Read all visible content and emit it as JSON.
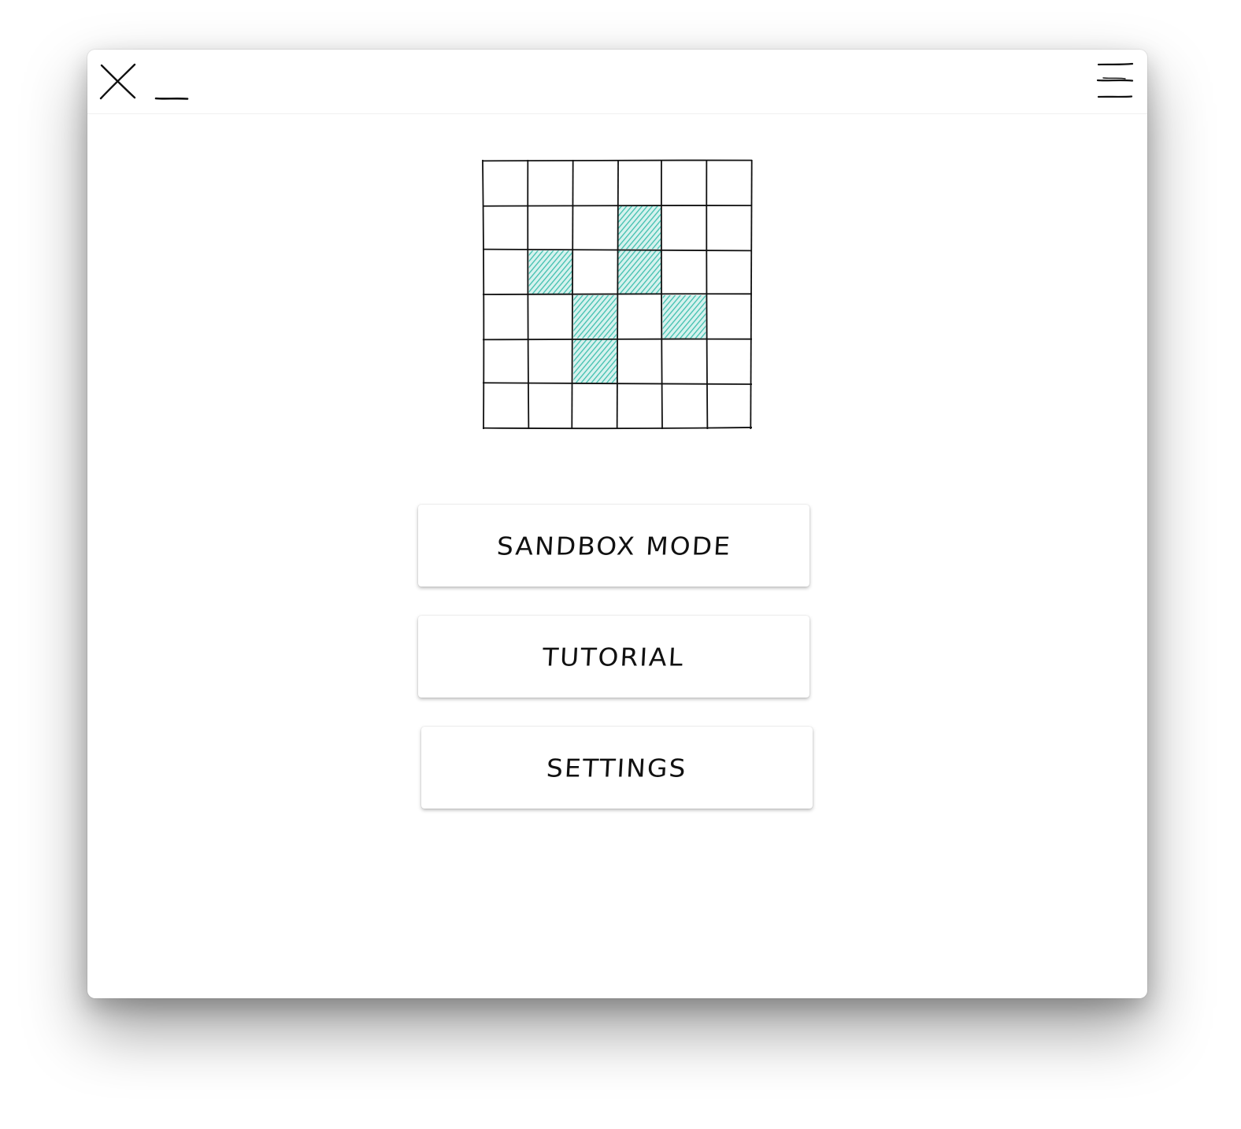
{
  "titlebar": {
    "close_icon": "close-icon",
    "minimize_icon": "minimize-icon",
    "menu_icon": "hamburger-menu-icon"
  },
  "board": {
    "rows": 6,
    "cols": 6,
    "fill_color": "#3fbfae",
    "line_color": "#111111",
    "filled_cells": [
      [
        1,
        3
      ],
      [
        2,
        1
      ],
      [
        2,
        3
      ],
      [
        3,
        2
      ],
      [
        3,
        4
      ],
      [
        4,
        2
      ]
    ]
  },
  "menu": {
    "sandbox_label": "SANDBOX MODE",
    "tutorial_label": "TUTORIAL",
    "settings_label": "SETTINGS"
  }
}
